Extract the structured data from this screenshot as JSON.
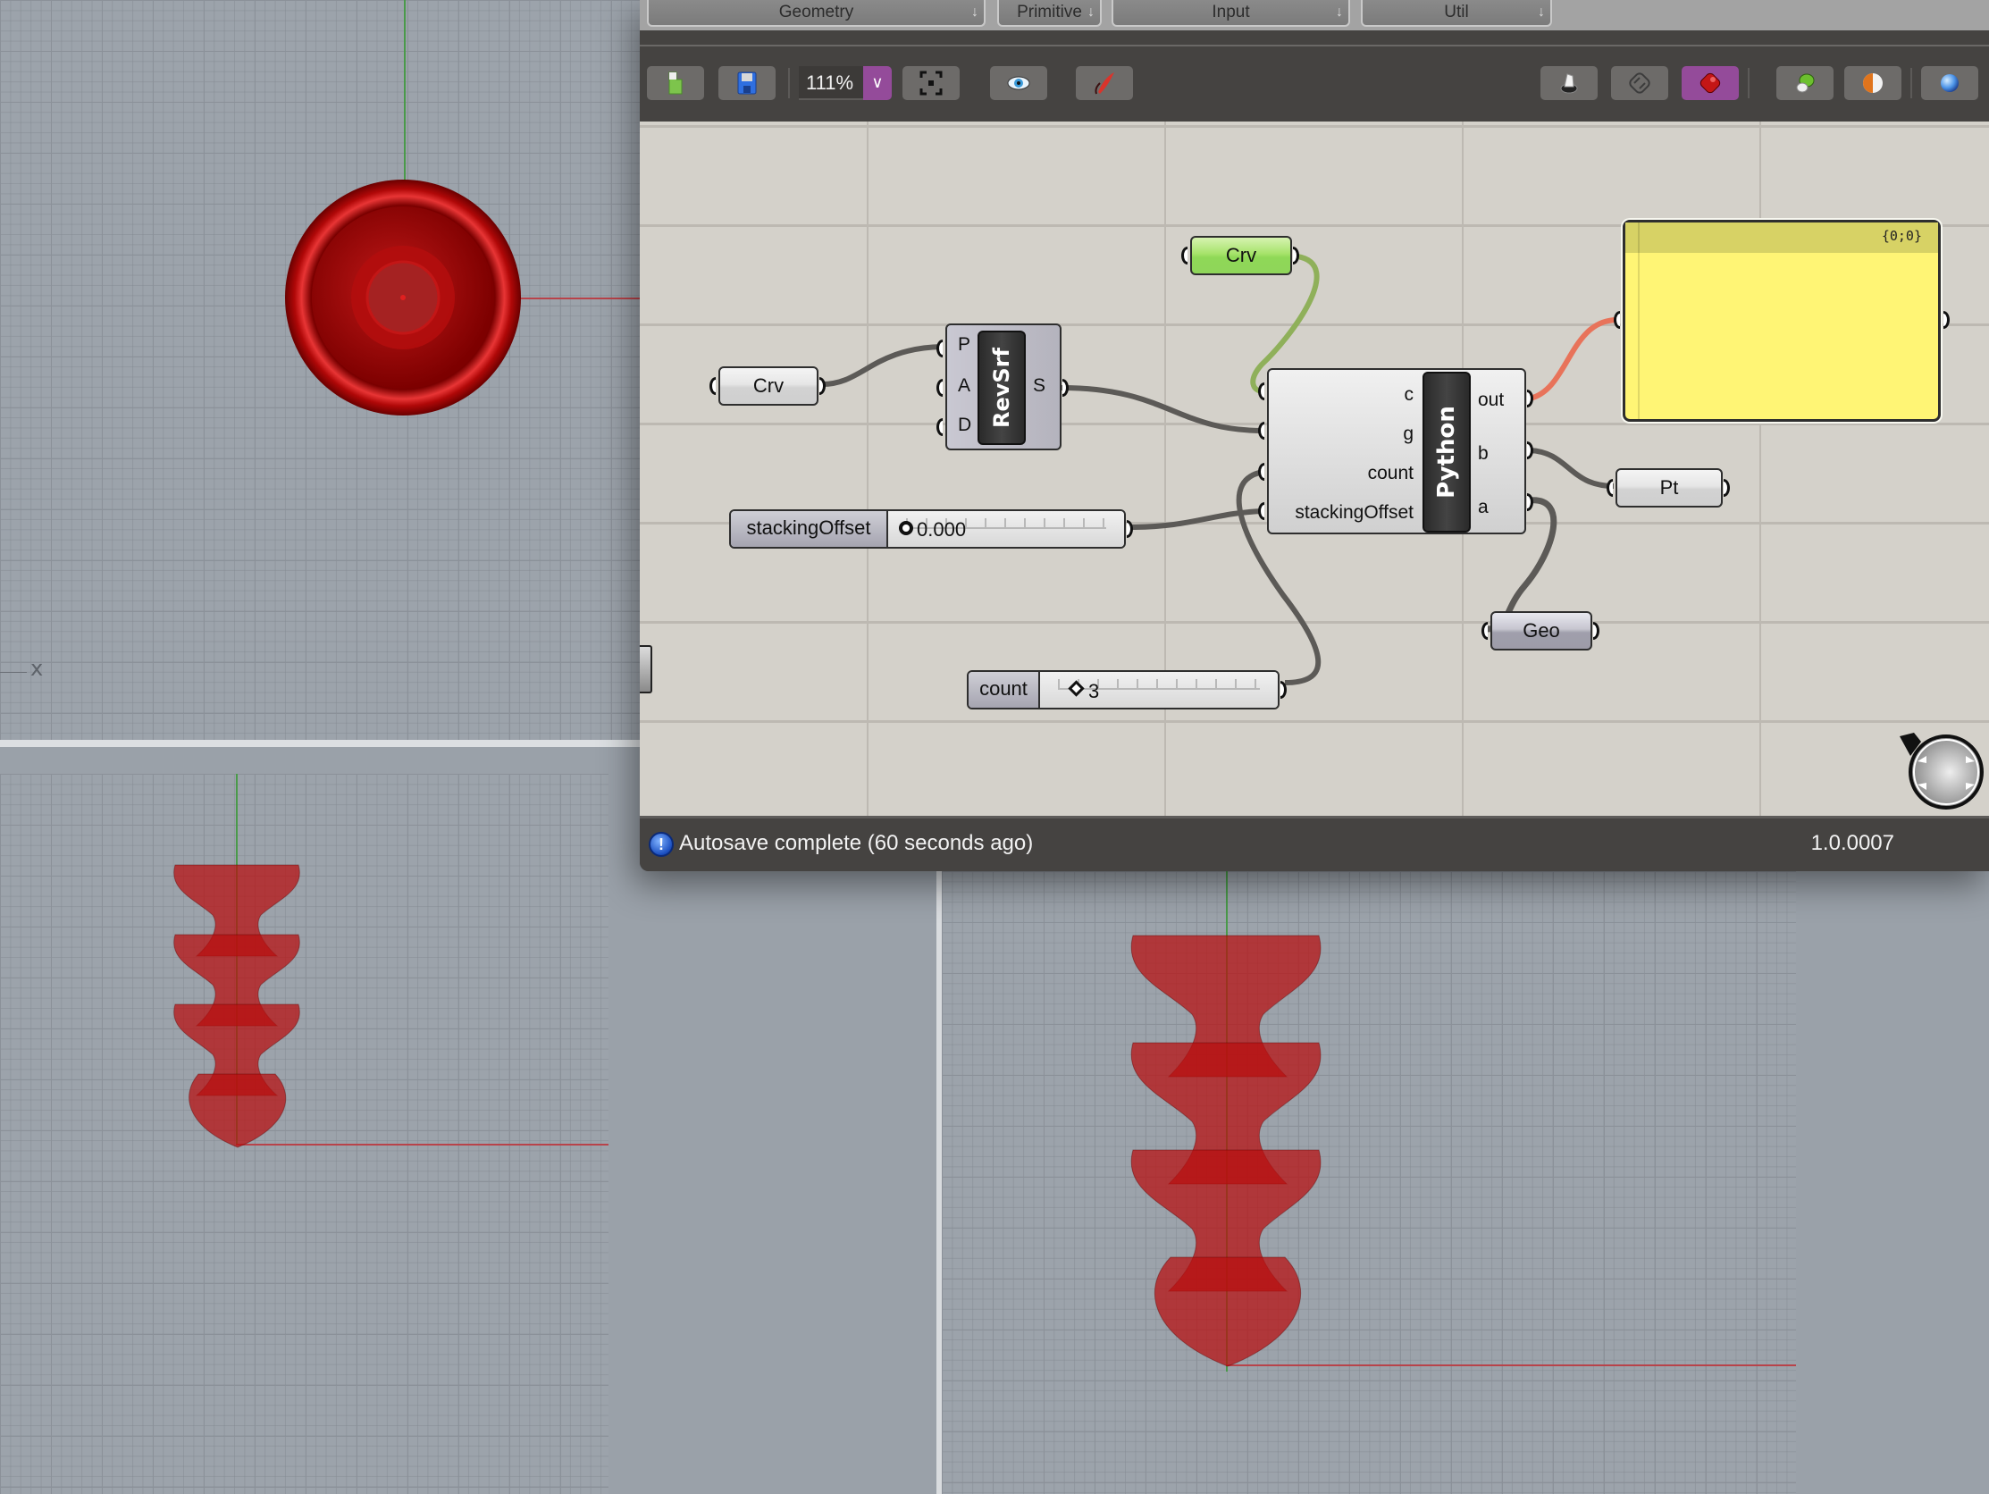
{
  "viewports": {
    "top": {
      "axis_label": "x"
    },
    "front": {},
    "perspective": {}
  },
  "grasshopper": {
    "tabs": [
      {
        "label": "Geometry"
      },
      {
        "label": "Primitive"
      },
      {
        "label": "Input"
      },
      {
        "label": "Util"
      }
    ],
    "toolbar": {
      "zoom_level": "111%",
      "buttons": [
        {
          "name": "open-file",
          "icon": "folder-icon"
        },
        {
          "name": "save-file",
          "icon": "floppy-disk-icon"
        },
        {
          "name": "zoom-extents",
          "icon": "zoom-extents-icon"
        },
        {
          "name": "preview-toggle",
          "icon": "eye-icon"
        },
        {
          "name": "sketch",
          "icon": "pen-icon"
        },
        {
          "name": "preview-wireframe",
          "icon": "wireframe-preview-icon"
        },
        {
          "name": "preview-none",
          "icon": "no-preview-icon"
        },
        {
          "name": "preview-shaded",
          "icon": "shaded-preview-icon",
          "active": true
        },
        {
          "name": "preview-selected",
          "icon": "selected-preview-icon"
        },
        {
          "name": "document-preview-settings",
          "icon": "material-sphere-icon"
        },
        {
          "name": "preview-mesh-quality",
          "icon": "blue-sphere-icon"
        }
      ],
      "active_color": "#944b9a"
    },
    "canvas": {
      "nodes": {
        "crv_left": {
          "label": "Crv"
        },
        "crv_top": {
          "label": "Crv"
        },
        "revsrf": {
          "title": "RevSrf",
          "inputs": [
            "P",
            "A",
            "D"
          ],
          "outputs": [
            "S"
          ]
        },
        "python": {
          "title": "Python",
          "inputs": [
            "c",
            "g",
            "count",
            "stackingOffset"
          ],
          "outputs": [
            "out",
            "b",
            "a"
          ]
        },
        "stacking_slider": {
          "label": "stackingOffset",
          "value": "0.000",
          "value_numeric": 0.0
        },
        "count_slider": {
          "label": "count",
          "value": "3",
          "value_numeric": 3
        },
        "panel": {
          "path": "{0;0}",
          "content": ""
        },
        "pt": {
          "label": "Pt"
        },
        "geo": {
          "label": "Geo"
        }
      },
      "wire_colors": {
        "default": "#5c5a57",
        "selected_green": "#8fc45a",
        "error_orange": "#e8735a"
      }
    },
    "status": {
      "message": "Autosave complete (60 seconds ago)",
      "version": "1.0.0007"
    }
  }
}
